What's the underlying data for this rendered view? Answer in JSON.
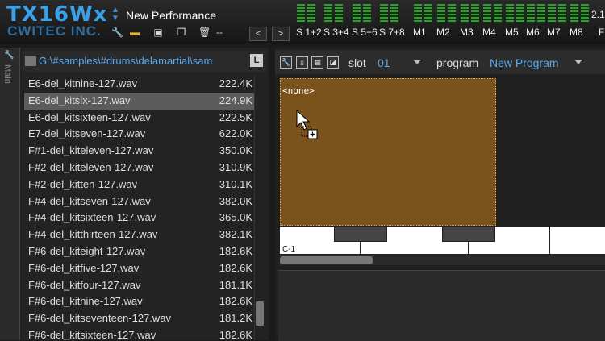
{
  "app": {
    "logo": "TX16Wx",
    "company": "CWITEC INC.",
    "performance": "New Performance",
    "version": "2.1",
    "toolbar_dash": "--",
    "prev": "<",
    "next": ">",
    "last_label": "F"
  },
  "channels": [
    "S 1+2",
    "S 3+4",
    "S 5+6",
    "S 7+8",
    "M1",
    "M2",
    "M3",
    "M4",
    "M5",
    "M6",
    "M7",
    "M8"
  ],
  "sidebar": {
    "main_label": "Main"
  },
  "browser": {
    "path": "G:\\#samples\\#drums\\delamartial\\sam",
    "path_button": "L",
    "files": [
      {
        "name": "E6-del_kitnine-127.wav",
        "size": "222.4K"
      },
      {
        "name": "E6-del_kitsix-127.wav",
        "size": "224.9K"
      },
      {
        "name": "E6-del_kitsixteen-127.wav",
        "size": "222.5K"
      },
      {
        "name": "E7-del_kitseven-127.wav",
        "size": "622.0K"
      },
      {
        "name": "F#1-del_kiteleven-127.wav",
        "size": "350.0K"
      },
      {
        "name": "F#2-del_kiteleven-127.wav",
        "size": "310.9K"
      },
      {
        "name": "F#2-del_kitten-127.wav",
        "size": "310.1K"
      },
      {
        "name": "F#4-del_kitseven-127.wav",
        "size": "382.0K"
      },
      {
        "name": "F#4-del_kitsixteen-127.wav",
        "size": "365.0K"
      },
      {
        "name": "F#4-del_kitthirteen-127.wav",
        "size": "382.1K"
      },
      {
        "name": "F#6-del_kiteight-127.wav",
        "size": "182.6K"
      },
      {
        "name": "F#6-del_kitfive-127.wav",
        "size": "182.6K"
      },
      {
        "name": "F#6-del_kitfour-127.wav",
        "size": "181.1K"
      },
      {
        "name": "F#6-del_kitnine-127.wav",
        "size": "182.6K"
      },
      {
        "name": "F#6-del_kitseventeen-127.wav",
        "size": "181.2K"
      },
      {
        "name": "F#6-del_kitsixteen-127.wav",
        "size": "182.6K"
      }
    ],
    "selected_index": 1
  },
  "editor": {
    "slot_label": "slot",
    "slot_value": "01",
    "program_label": "program",
    "program_value": "New Program",
    "zone_label": "<none>",
    "key_label": "C-1",
    "zone_color": "#7a521c"
  }
}
